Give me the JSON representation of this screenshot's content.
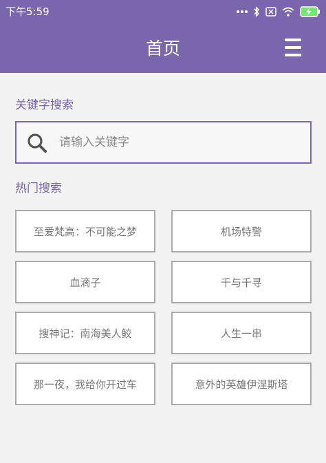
{
  "status_bar": {
    "time": "下午5:59",
    "icons": [
      "more-dots-icon",
      "bluetooth-icon",
      "sim-off-icon",
      "wifi-icon",
      "battery-charging-icon"
    ]
  },
  "app_bar": {
    "title": "首页",
    "menu_icon": "hamburger-menu-icon"
  },
  "search": {
    "section_label": "关键字搜索",
    "placeholder": "请输入关键字",
    "value": "",
    "icon": "search-icon"
  },
  "hot_search": {
    "section_label": "热门搜索",
    "items": [
      "至爱梵高：不可能之梦",
      "机场特警",
      "血滴子",
      "千与千寻",
      "搜神记：南海美人鲛",
      "人生一串",
      "那一夜，我给你开过车",
      "意外的英雄伊涅斯塔"
    ]
  },
  "colors": {
    "primary": "#7966ad",
    "background": "#f2f2f2",
    "tile_border": "#a9a9a9",
    "tile_text": "#777777"
  }
}
